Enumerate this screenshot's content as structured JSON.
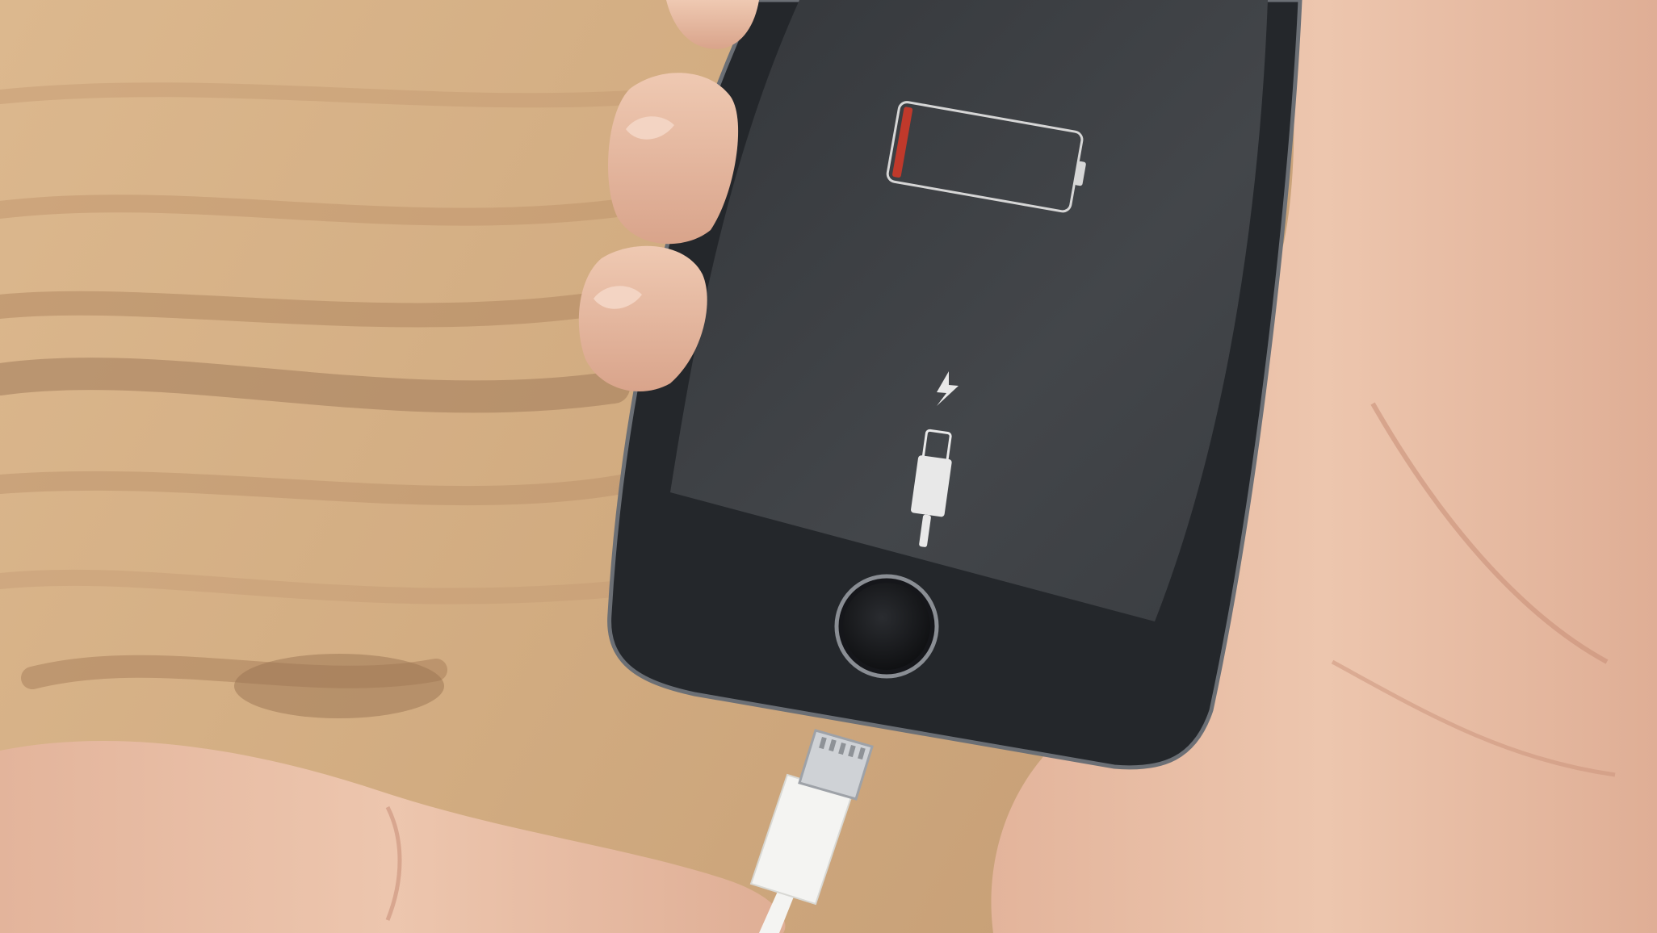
{
  "scene": {
    "subject": "phone-charging-prompt",
    "battery_level": 0.05,
    "colors": {
      "wood_light": "#dcb88e",
      "wood_mid": "#c9a27a",
      "wood_dark": "#9c7656",
      "phone_body": "#24272b",
      "phone_screen": "#3d4044",
      "battery_outline": "#d6d6d6",
      "battery_low": "#c0392b",
      "icon_white": "#e8e8e8",
      "skin": "#e9bfa6",
      "skin_shadow": "#c9917a",
      "cable": "#f4f4f2"
    },
    "icons": [
      "empty-battery-icon",
      "lightning-bolt-icon",
      "lightning-cable-icon",
      "home-button"
    ]
  }
}
